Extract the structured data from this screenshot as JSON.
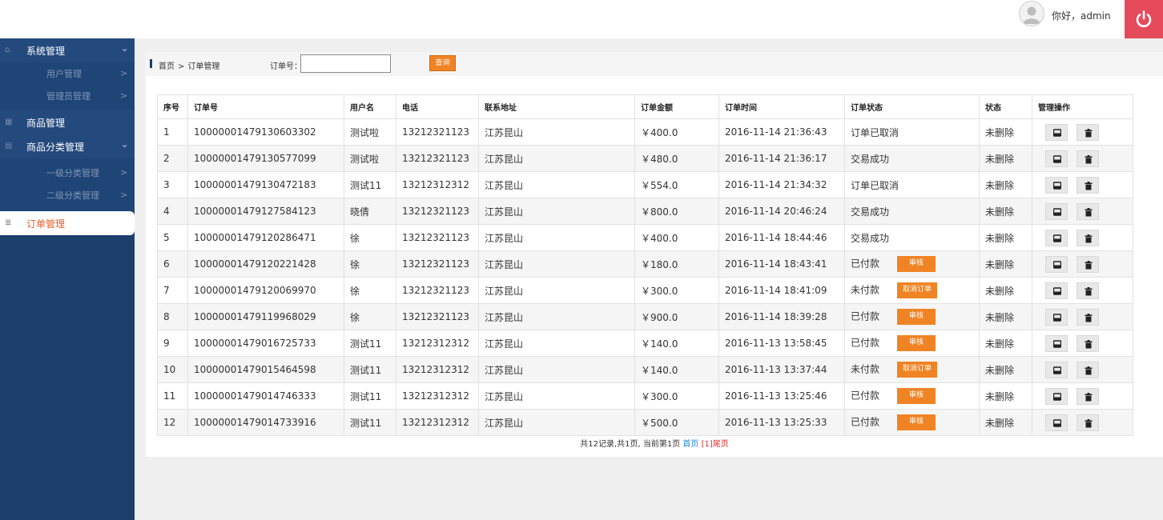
{
  "header": {
    "greeting": "你好，admin",
    "power_icon": "power-icon",
    "avatar_icon": "user-avatar-icon"
  },
  "sidebar": {
    "items": [
      {
        "label": "系统管理",
        "icon": "home-icon",
        "expanded": true,
        "children": [
          {
            "label": "用户管理"
          },
          {
            "label": "管理员管理"
          }
        ]
      },
      {
        "label": "商品管理",
        "icon": "calendar-icon"
      },
      {
        "label": "商品分类管理",
        "icon": "grid-icon",
        "expanded": true,
        "children": [
          {
            "label": "一级分类管理"
          },
          {
            "label": "二级分类管理"
          }
        ]
      },
      {
        "label": "订单管理",
        "icon": "list-icon",
        "active": true
      }
    ]
  },
  "breadcrumb": {
    "home": "首页",
    "sep": ">",
    "current": "订单管理"
  },
  "search": {
    "label": "订单号：",
    "value": "",
    "button": "查询"
  },
  "table": {
    "headers": [
      "序号",
      "订单号",
      "用户名",
      "电话",
      "联系地址",
      "订单金额",
      "订单时间",
      "订单状态",
      "状态",
      "管理操作"
    ],
    "rows": [
      {
        "no": "1",
        "order_id": "10000001479130603302",
        "user": "测试啦",
        "phone": "13212321123",
        "address": "江苏昆山",
        "amount": "￥400.0",
        "time": "2016-11-14 21:36:43",
        "status": "订单已取消",
        "action": "",
        "state": "未删除"
      },
      {
        "no": "2",
        "order_id": "10000001479130577099",
        "user": "测试啦",
        "phone": "13212321123",
        "address": "江苏昆山",
        "amount": "￥480.0",
        "time": "2016-11-14 21:36:17",
        "status": "交易成功",
        "action": "",
        "state": "未删除"
      },
      {
        "no": "3",
        "order_id": "10000001479130472183",
        "user": "测试11",
        "phone": "13212312312",
        "address": "江苏昆山",
        "amount": "￥554.0",
        "time": "2016-11-14 21:34:32",
        "status": "订单已取消",
        "action": "",
        "state": "未删除"
      },
      {
        "no": "4",
        "order_id": "10000001479127584123",
        "user": "晓倩",
        "phone": "13212321123",
        "address": "江苏昆山",
        "amount": "￥800.0",
        "time": "2016-11-14 20:46:24",
        "status": "交易成功",
        "action": "",
        "state": "未删除"
      },
      {
        "no": "5",
        "order_id": "10000001479120286471",
        "user": "徐",
        "phone": "13212321123",
        "address": "江苏昆山",
        "amount": "￥400.0",
        "time": "2016-11-14 18:44:46",
        "status": "交易成功",
        "action": "",
        "state": "未删除"
      },
      {
        "no": "6",
        "order_id": "10000001479120221428",
        "user": "徐",
        "phone": "13212321123",
        "address": "江苏昆山",
        "amount": "￥180.0",
        "time": "2016-11-14 18:43:41",
        "status": "已付款",
        "action": "审核",
        "state": "未删除"
      },
      {
        "no": "7",
        "order_id": "10000001479120069970",
        "user": "徐",
        "phone": "13212321123",
        "address": "江苏昆山",
        "amount": "￥300.0",
        "time": "2016-11-14 18:41:09",
        "status": "未付款",
        "action": "取消订单",
        "state": "未删除"
      },
      {
        "no": "8",
        "order_id": "10000001479119968029",
        "user": "徐",
        "phone": "13212321123",
        "address": "江苏昆山",
        "amount": "￥900.0",
        "time": "2016-11-14 18:39:28",
        "status": "已付款",
        "action": "审核",
        "state": "未删除"
      },
      {
        "no": "9",
        "order_id": "10000001479016725733",
        "user": "测试11",
        "phone": "13212312312",
        "address": "江苏昆山",
        "amount": "￥140.0",
        "time": "2016-11-13 13:58:45",
        "status": "已付款",
        "action": "审核",
        "state": "未删除"
      },
      {
        "no": "10",
        "order_id": "10000001479015464598",
        "user": "测试11",
        "phone": "13212312312",
        "address": "江苏昆山",
        "amount": "￥140.0",
        "time": "2016-11-13 13:37:44",
        "status": "未付款",
        "action": "取消订单",
        "state": "未删除"
      },
      {
        "no": "11",
        "order_id": "10000001479014746333",
        "user": "测试11",
        "phone": "13212312312",
        "address": "江苏昆山",
        "amount": "￥300.0",
        "time": "2016-11-13 13:25:46",
        "status": "已付款",
        "action": "审核",
        "state": "未删除"
      },
      {
        "no": "12",
        "order_id": "10000001479014733916",
        "user": "测试11",
        "phone": "13212312312",
        "address": "江苏昆山",
        "amount": "￥500.0",
        "time": "2016-11-13 13:25:33",
        "status": "已付款",
        "action": "审核",
        "state": "未删除"
      }
    ],
    "row_actions": {
      "view_icon": "view-icon",
      "delete_icon": "trash-icon"
    }
  },
  "pager": {
    "summary": "共12记录,共1页, 当前第1页 ",
    "first": "首页",
    "current": "[1]",
    "last": "尾页"
  },
  "colors": {
    "sidebar": "#1c3f6e",
    "accent": "#f08424",
    "power": "#e64b5c",
    "active_text": "#e85b26"
  }
}
